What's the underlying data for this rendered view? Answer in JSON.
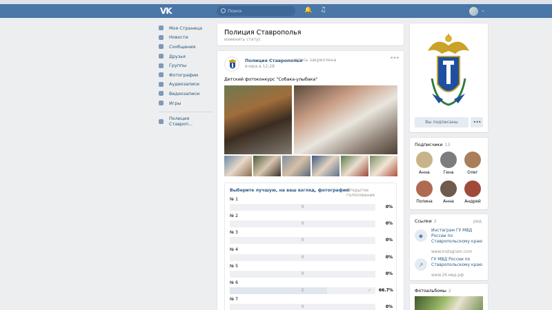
{
  "header": {
    "logo": "VK",
    "search_placeholder": "Поиск"
  },
  "left_nav": {
    "items": [
      {
        "label": "Моя Страница",
        "icon": "home-icon"
      },
      {
        "label": "Новости",
        "icon": "news-icon"
      },
      {
        "label": "Сообщения",
        "icon": "messages-icon"
      },
      {
        "label": "Друзья",
        "icon": "friends-icon"
      },
      {
        "label": "Группы",
        "icon": "groups-icon"
      },
      {
        "label": "Фотографии",
        "icon": "photos-icon"
      },
      {
        "label": "Аудиозаписи",
        "icon": "audio-icon"
      },
      {
        "label": "Видеозаписи",
        "icon": "video-icon"
      },
      {
        "label": "Игры",
        "icon": "games-icon"
      }
    ],
    "pinned_group": "Полиция Ставроп..."
  },
  "profile": {
    "title": "Полиция Ставрополья",
    "status_link": "изменить статус"
  },
  "post": {
    "author": "Полиция Ставрополья",
    "pinned": "запись закреплена",
    "time": "вчера в 12:28",
    "text": "Детский фотоконкурс \"Собака-улыбака\"",
    "poll": {
      "question": "Выберите лучшую, на ваш взгляд, фотографию",
      "type": "Открытое голосование",
      "options": [
        {
          "label": "№ 1",
          "count": "0",
          "percent": "0%",
          "share": 0
        },
        {
          "label": "№ 2",
          "count": "0",
          "percent": "0%",
          "share": 0
        },
        {
          "label": "№ 3",
          "count": "0",
          "percent": "0%",
          "share": 0
        },
        {
          "label": "№ 4",
          "count": "0",
          "percent": "0%",
          "share": 0
        },
        {
          "label": "№ 5",
          "count": "0",
          "percent": "0%",
          "share": 0
        },
        {
          "label": "№ 6",
          "count": "2",
          "percent": "66.7%",
          "share": 0.667,
          "voted": true
        },
        {
          "label": "№ 7",
          "count": "0",
          "percent": "0%",
          "share": 0
        }
      ]
    }
  },
  "right": {
    "subscribed_button": "Вы подписаны",
    "subscribers": {
      "title": "Подписчики",
      "count": "13",
      "people": [
        {
          "name": "Анна",
          "color": "#c8b48a"
        },
        {
          "name": "Гена",
          "color": "#7b7d80"
        },
        {
          "name": "Олег",
          "color": "#a87f5a"
        },
        {
          "name": "Полина",
          "color": "#b06a52"
        },
        {
          "name": "Анна",
          "color": "#6f5a4d"
        },
        {
          "name": "Андрей",
          "color": "#a04a3a"
        }
      ]
    },
    "links": {
      "title": "Ссылки",
      "count": "2",
      "edit": "ред.",
      "items": [
        {
          "title": "Инстаграм ГУ МВД России по Ставропольскому краю",
          "url": "www.instagram.com"
        },
        {
          "title": "ГУ МВД России по Ставропольскому краю",
          "url": "www.26.мвд.рф"
        }
      ]
    },
    "albums": {
      "title": "Фотоальбомы",
      "count": "2"
    }
  }
}
